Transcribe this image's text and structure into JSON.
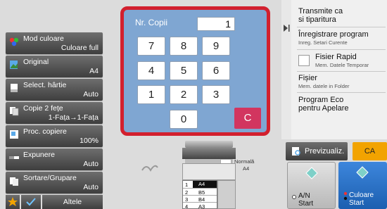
{
  "left_menu": [
    {
      "label": "Mod culoare",
      "value": "Culoare full"
    },
    {
      "label": "Original",
      "value": "A4"
    },
    {
      "label": "Select. hârtie",
      "value": "Auto"
    },
    {
      "label": "Copie 2 fețe",
      "value": "1-Fața→1-Fața"
    },
    {
      "label": "Proc. copiere",
      "value": "100%"
    },
    {
      "label": "Expunere",
      "value": "Auto"
    },
    {
      "label": "Sortare/Grupare",
      "value": "Auto"
    }
  ],
  "bottom_left": {
    "other_label": "Altele"
  },
  "keypad": {
    "label": "Nr. Copii",
    "value": "1",
    "keys": [
      "7",
      "8",
      "9",
      "4",
      "5",
      "6",
      "1",
      "2",
      "3",
      "0"
    ],
    "clear_label": "C"
  },
  "right_panel": {
    "items": [
      {
        "title": "Transmite ca\nsi tiparitura",
        "sub": ""
      },
      {
        "title": "Înregistrare program",
        "sub": "Inreg. Setari Curente"
      },
      {
        "title": "Fisier Rapid",
        "sub": "Mem. Datele Temporar"
      },
      {
        "title": "Fișier",
        "sub": "Mem. datele in Folder"
      },
      {
        "title": "Program Eco\npentru Apelare",
        "sub": ""
      }
    ]
  },
  "preview": {
    "label": "Previzualiz.",
    "ca_label": "CA"
  },
  "machine": {
    "output_label": "Normală",
    "output_size": "A4",
    "trays": [
      {
        "num": "1",
        "size": "A4"
      },
      {
        "num": "2",
        "size": "B5"
      },
      {
        "num": "3",
        "size": "B4"
      },
      {
        "num": "4",
        "size": "A3"
      }
    ]
  },
  "start_buttons": {
    "bw_label": "A/N",
    "bw_sub": "Start",
    "color_label": "Culoare",
    "color_sub": "Start"
  },
  "colors": {
    "accent_red": "#d2202e",
    "keypad_bg": "#7fa6d2",
    "ca_orange": "#f2a300",
    "color_start_blue": "#2a6fc4"
  }
}
